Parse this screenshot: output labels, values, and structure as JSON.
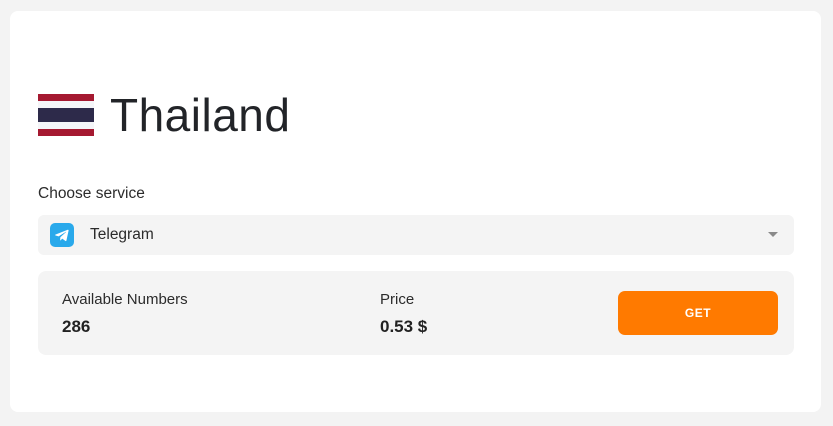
{
  "country": {
    "name": "Thailand",
    "flag_icon": "thailand-flag-icon",
    "flag_colors": [
      "#a51931",
      "#f4f5f8",
      "#2d2a4a"
    ]
  },
  "service": {
    "label": "Choose service",
    "selected": "Telegram",
    "icon": "telegram-icon",
    "icon_color": "#29a9eb"
  },
  "offer": {
    "available_label": "Available Numbers",
    "available_value": "286",
    "price_label": "Price",
    "price_value": "0.53 $",
    "button_label": "GET",
    "button_color": "#ff7a00"
  }
}
